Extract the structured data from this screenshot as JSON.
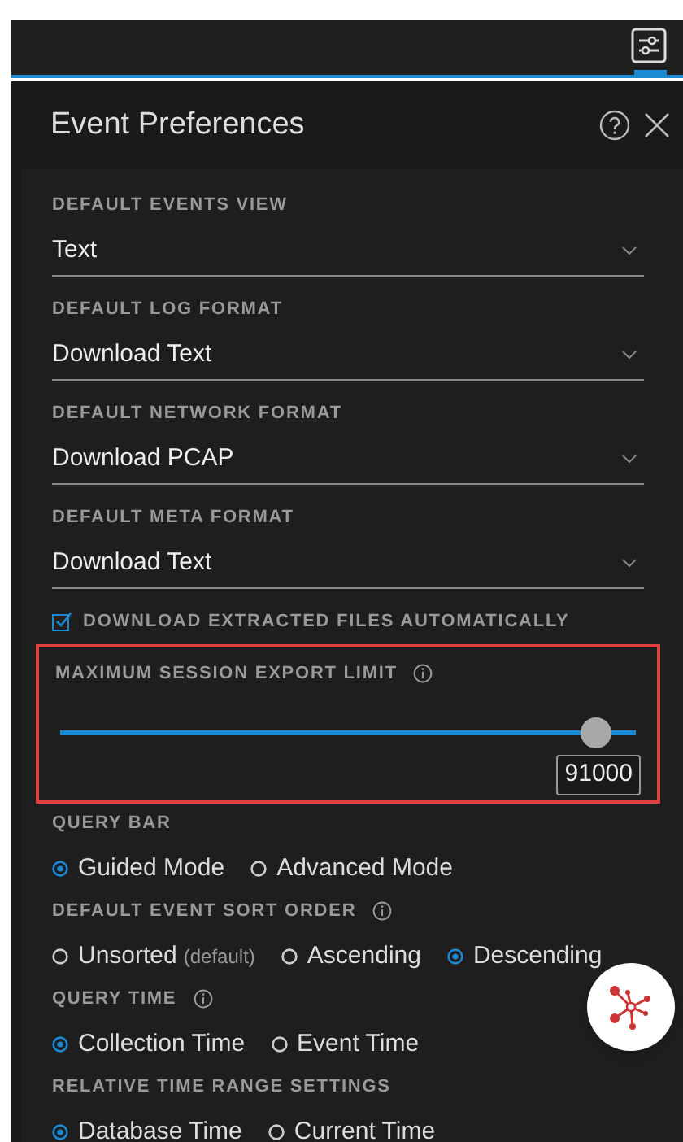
{
  "panel": {
    "title": "Event Preferences"
  },
  "sections": [
    {
      "kind": "select",
      "label": "DEFAULT EVENTS VIEW",
      "value": "Text"
    },
    {
      "kind": "select",
      "label": "DEFAULT LOG FORMAT",
      "value": "Download Text"
    },
    {
      "kind": "select",
      "label": "DEFAULT NETWORK FORMAT",
      "value": "Download PCAP"
    },
    {
      "kind": "select",
      "label": "DEFAULT META FORMAT",
      "value": "Download Text"
    },
    {
      "kind": "checkbox",
      "label": "DOWNLOAD EXTRACTED FILES AUTOMATICALLY",
      "checked": true
    },
    {
      "kind": "slider",
      "label": "MAXIMUM SESSION EXPORT LIMIT",
      "info": true,
      "highlighted": true,
      "level": 0.93,
      "value": "91000"
    },
    {
      "kind": "radio",
      "label": "QUERY BAR",
      "info": false,
      "options": [
        {
          "label": "Guided Mode",
          "selected": true
        },
        {
          "label": "Advanced Mode",
          "selected": false
        }
      ]
    },
    {
      "kind": "radio",
      "label": "DEFAULT EVENT SORT ORDER",
      "info": true,
      "options": [
        {
          "label": "Unsorted",
          "note": "(default)",
          "selected": false
        },
        {
          "label": "Ascending",
          "selected": false
        },
        {
          "label": "Descending",
          "selected": true
        }
      ]
    },
    {
      "kind": "radio",
      "label": "QUERY TIME",
      "info": true,
      "options": [
        {
          "label": "Collection Time",
          "selected": true
        },
        {
          "label": "Event Time",
          "selected": false
        }
      ]
    },
    {
      "kind": "radio",
      "label": "RELATIVE TIME RANGE SETTINGS",
      "info": false,
      "options": [
        {
          "label": "Database Time",
          "selected": true
        },
        {
          "label": "Current Time",
          "selected": false
        }
      ]
    }
  ]
}
